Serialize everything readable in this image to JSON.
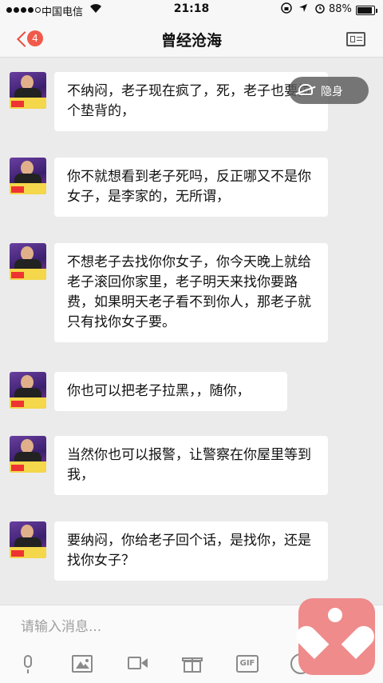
{
  "status_bar": {
    "carrier": "中国电信",
    "time": "21:18",
    "battery": "88%"
  },
  "nav": {
    "title": "曾经沧海",
    "unread_count": "4"
  },
  "messages": [
    {
      "text": "不纳闷，老子现在疯了，死，老子也要拉个垫背的，"
    },
    {
      "text": "你不就想看到老子死吗，反正哪又不是你女子，是李家的，无所谓，"
    },
    {
      "text": "不想老子去找你你女子，你今天晚上就给老子滚回你家里，老子明天来找你要路费，如果明天老子看不到你人，那老子就只有找你女子要。"
    },
    {
      "text": "你也可以把老子拉黑，，随你，"
    },
    {
      "text": "当然你也可以报警，让警察在你屋里等到我，"
    },
    {
      "text": "要纳闷，你给老子回个话，是找你，还是找你女子？"
    }
  ],
  "stealth": {
    "label": "隐身"
  },
  "input": {
    "placeholder": "请输入消息..."
  },
  "toolbar": {
    "gif_label": "GIF"
  },
  "colors": {
    "accent": "#e94c3c",
    "badge": "#f05a4a",
    "float_app": "#ef8b8b"
  }
}
